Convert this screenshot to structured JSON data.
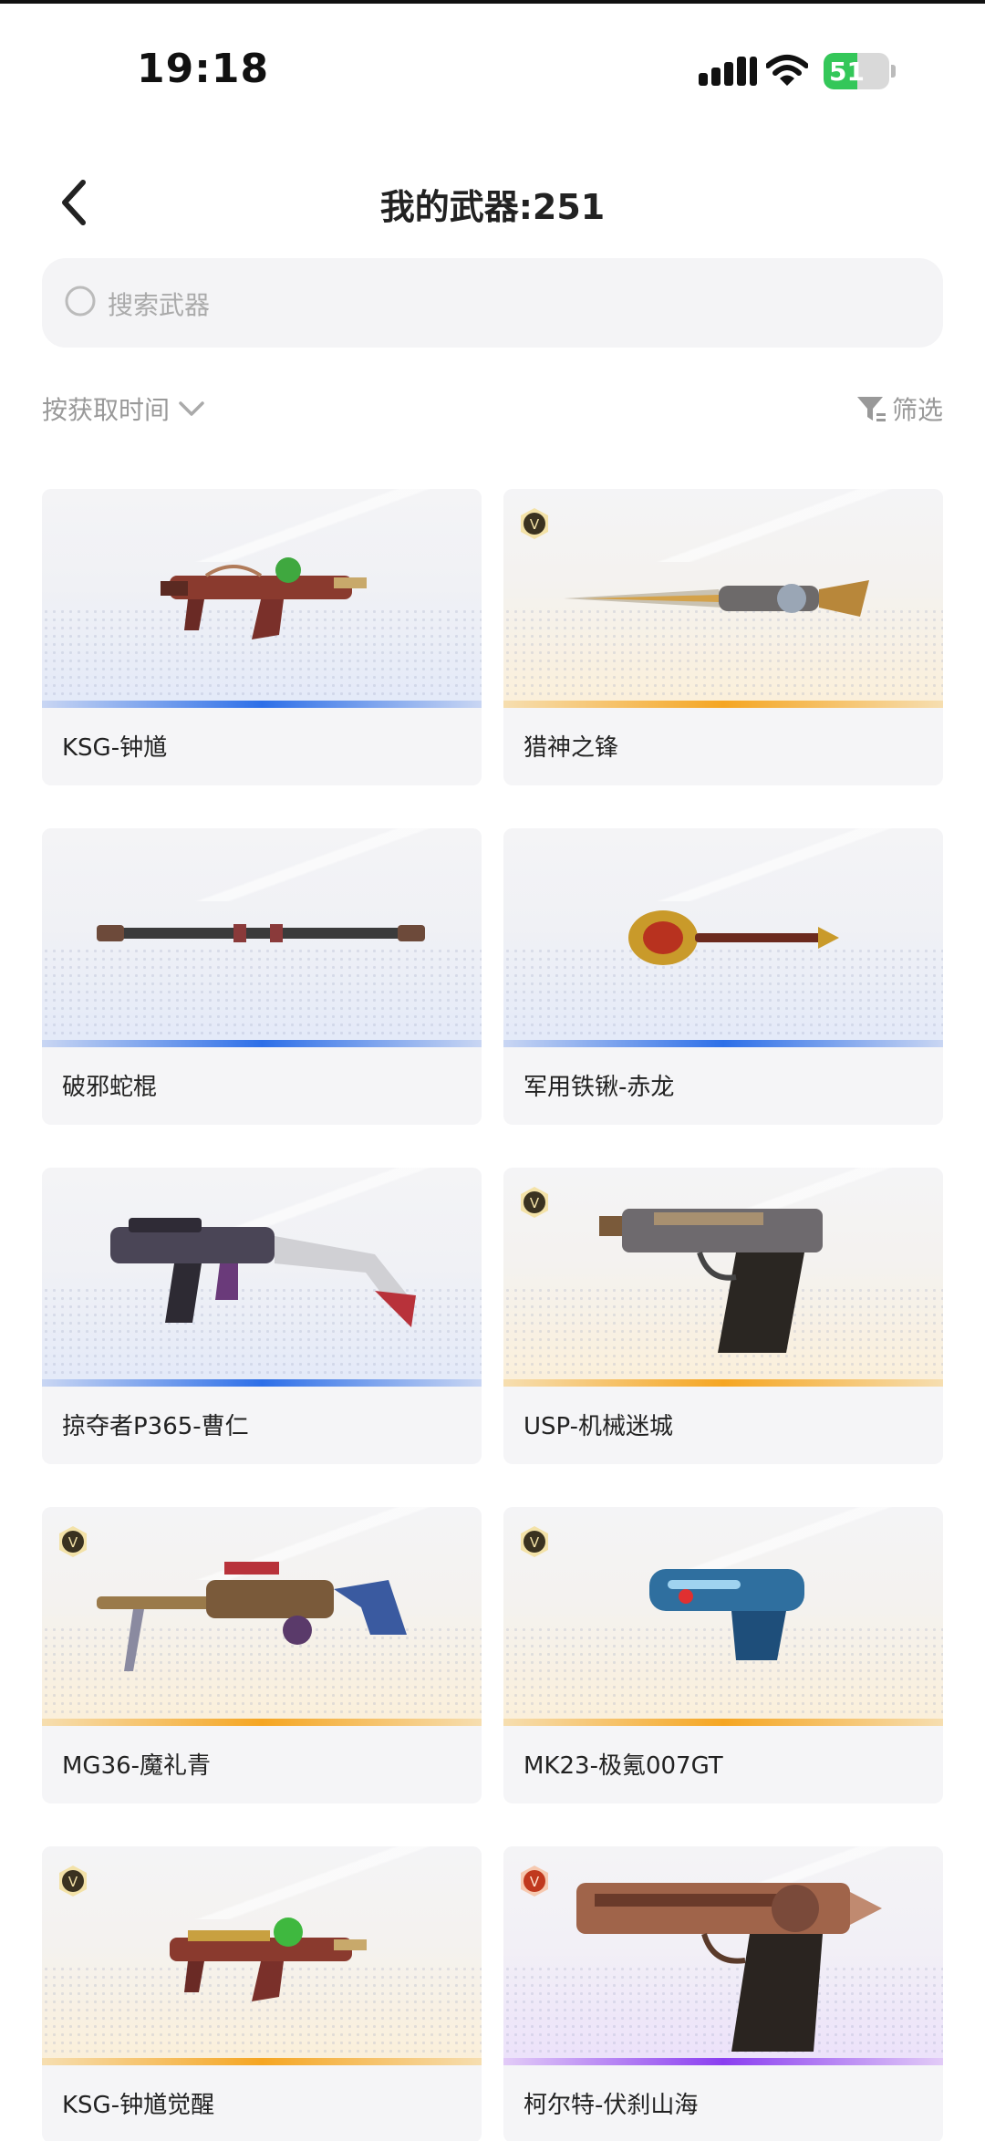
{
  "status_bar": {
    "time": "19:18",
    "battery": "51",
    "battery_level": 0.51
  },
  "header": {
    "title": "我的武器:251"
  },
  "search": {
    "placeholder": "搜索武器"
  },
  "sort": {
    "label": "按获取时间"
  },
  "filter": {
    "label": "筛选"
  },
  "weapons": [
    {
      "name": "KSG-钟馗",
      "rarity": "blue",
      "badge": false
    },
    {
      "name": "猎神之锋",
      "rarity": "gold",
      "badge": true
    },
    {
      "name": "破邪蛇棍",
      "rarity": "blue",
      "badge": false
    },
    {
      "name": "军用铁锹-赤龙",
      "rarity": "blue",
      "badge": false
    },
    {
      "name": "掠夺者P365-曹仁",
      "rarity": "blue",
      "badge": false
    },
    {
      "name": "USP-机械迷城",
      "rarity": "gold",
      "badge": true
    },
    {
      "name": "MG36-魔礼青",
      "rarity": "gold",
      "badge": true
    },
    {
      "name": "MK23-极氪007GT",
      "rarity": "gold",
      "badge": true
    },
    {
      "name": "KSG-钟馗觉醒",
      "rarity": "gold",
      "badge": true
    },
    {
      "name": "柯尔特-伏刹山海",
      "rarity": "purple",
      "badge": true
    }
  ],
  "colors": {
    "blue_rarity": "#2d6fe8",
    "gold_rarity": "#f5a623",
    "purple_rarity": "#8a3ef0",
    "battery_green": "#34c759"
  }
}
